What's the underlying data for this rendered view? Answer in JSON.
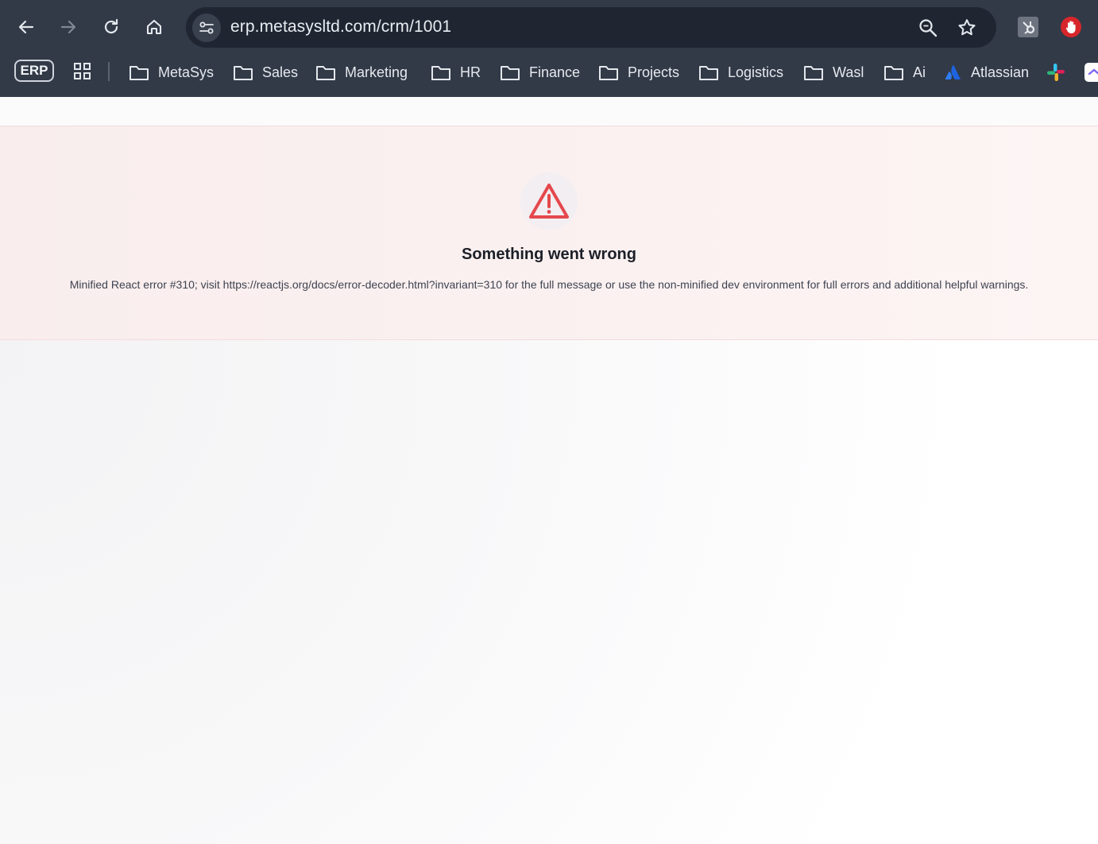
{
  "browser": {
    "url": "erp.metasysltd.com/crm/1001",
    "erp_label": "ERP",
    "bookmarks": [
      {
        "label": "MetaSys"
      },
      {
        "label": "Sales"
      },
      {
        "label": "Marketing"
      },
      {
        "label": "HR"
      },
      {
        "label": "Finance"
      },
      {
        "label": "Projects"
      },
      {
        "label": "Logistics"
      },
      {
        "label": "Wasl"
      },
      {
        "label": "Ai"
      },
      {
        "label": "Atlassian"
      }
    ]
  },
  "error": {
    "title": "Something went wrong",
    "message": "Minified React error #310; visit https://reactjs.org/docs/error-decoder.html?invariant=310 for the full message or use the non-minified dev environment for full errors and additional helpful warnings."
  },
  "colors": {
    "chrome_bg": "#323a48",
    "omnibox_bg": "#1f2632",
    "error_accent": "#e5484d",
    "error_bg": "#fbf0f0"
  }
}
